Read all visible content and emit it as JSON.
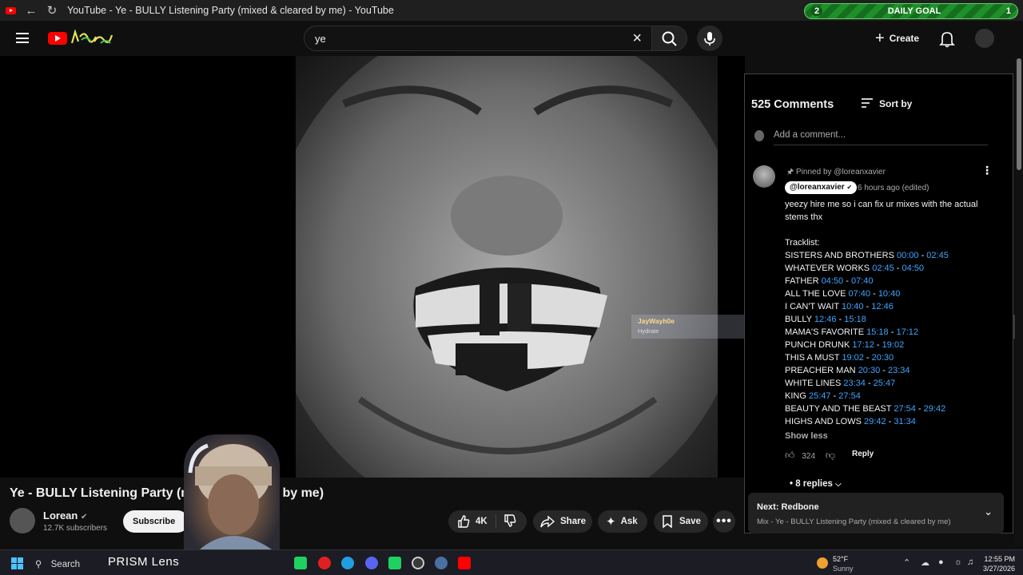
{
  "browser": {
    "tab_title": "YouTube - Ye - BULLY Listening Party (mixed & cleared by me) - YouTube",
    "daily_goal": {
      "label": "DAILY GOAL",
      "left_value": "2",
      "right_value": "1"
    }
  },
  "masthead": {
    "search_value": "ye",
    "create_label": "Create"
  },
  "video": {
    "title": "Ye - BULLY Listening Party (mixed & cleared by me)",
    "channel_name": "Lorean",
    "subscribers": "12.7K subscribers",
    "subscribe_label": "Subscribe",
    "like_count": "4K",
    "share_label": "Share",
    "ask_label": "Ask",
    "save_label": "Save"
  },
  "comments": {
    "count_label": "525 Comments",
    "sort_label": "Sort by",
    "add_placeholder": "Add a comment...",
    "pinned_label": "Pinned by @loreanxavier",
    "author": "@loreanxavier",
    "time": "6 hours ago (edited)",
    "intro_line1": "yeezy hire me so i can fix ur mixes with the actual",
    "intro_line2": "stems thx",
    "tracklist_label": "Tracklist:",
    "tracks": [
      {
        "name": "SISTERS AND BROTHERS",
        "start": "00:00",
        "end": "02:45"
      },
      {
        "name": "WHATEVER WORKS",
        "start": "02:45",
        "end": "04:50"
      },
      {
        "name": "FATHER",
        "start": "04:50",
        "end": "07:40"
      },
      {
        "name": "ALL THE LOVE",
        "start": "07:40",
        "end": "10:40"
      },
      {
        "name": "I CAN'T WAIT",
        "start": "10:40",
        "end": "12:46"
      },
      {
        "name": "BULLY",
        "start": "12:46",
        "end": "15:18"
      },
      {
        "name": "MAMA'S FAVORITE",
        "start": "15:18",
        "end": "17:12"
      },
      {
        "name": "PUNCH DRUNK",
        "start": "17:12",
        "end": "19:02"
      },
      {
        "name": "THIS A MUST",
        "start": "19:02",
        "end": "20:30"
      },
      {
        "name": "PREACHER MAN",
        "start": "20:30",
        "end": "23:34"
      },
      {
        "name": "WHITE LINES",
        "start": "23:34",
        "end": "25:47"
      },
      {
        "name": "KING",
        "start": "25:47",
        "end": "27:54"
      },
      {
        "name": "BEAUTY AND THE BEAST",
        "start": "27:54",
        "end": "29:42"
      },
      {
        "name": "HIGHS AND LOWS",
        "start": "29:42",
        "end": "31:34"
      }
    ],
    "show_less": "Show less",
    "likes": "324",
    "reply_label": "Reply",
    "replies_label": "• 8 replies"
  },
  "next": {
    "label": "Next: Redbone",
    "playlist": "Mix - Ye - BULLY Listening Party (mixed & cleared by me)"
  },
  "overlay": {
    "username": "JayWayh0e",
    "status": "Hydrate"
  },
  "taskbar": {
    "search_label": "Search",
    "prism_label": "PRISM Lens",
    "temperature": "52°F",
    "condition": "Sunny",
    "time": "12:55 PM",
    "date": "3/27/2026"
  },
  "colors": {
    "youtube_red": "#ff0000",
    "timestamp_blue": "#3ea6ff",
    "goal_green": "#1f8f2a"
  }
}
